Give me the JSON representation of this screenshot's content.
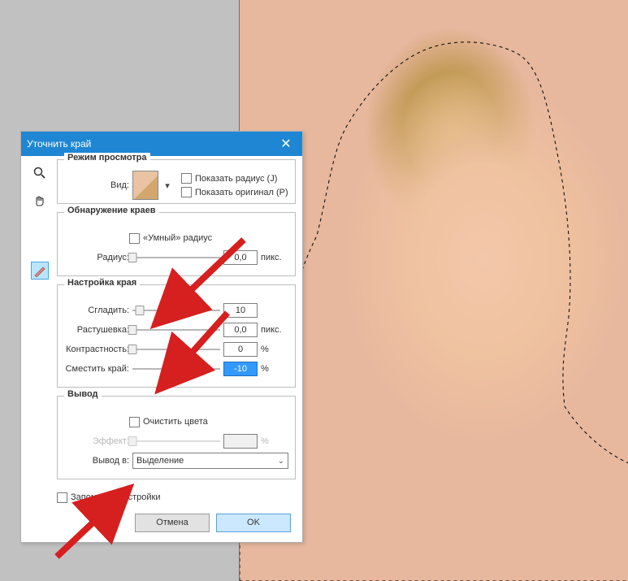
{
  "dialog": {
    "title": "Уточнить край",
    "view_section": {
      "title": "Режим просмотра",
      "view_label": "Вид:",
      "show_radius": "Показать радиус (J)",
      "show_original": "Показать оригинал (P)"
    },
    "edge_detect": {
      "title": "Обнаружение краев",
      "smart_radius": "«Умный» радиус",
      "radius_label": "Радиус:",
      "radius_value": "0,0",
      "radius_unit": "пикс."
    },
    "adjust": {
      "title": "Настройка края",
      "smooth_label": "Сгладить:",
      "smooth_value": "10",
      "feather_label": "Растушевка:",
      "feather_value": "0,0",
      "feather_unit": "пикс.",
      "contrast_label": "Контрастность:",
      "contrast_value": "0",
      "contrast_unit": "%",
      "shift_label": "Сместить край:",
      "shift_value": "-10",
      "shift_unit": "%"
    },
    "output": {
      "title": "Вывод",
      "decontaminate": "Очистить цвета",
      "effect_label": "Эффект:",
      "effect_unit": "%",
      "output_to_label": "Вывод в:",
      "output_to_value": "Выделение"
    },
    "remember_label": "Запомнить настройки",
    "cancel_label": "Отмена",
    "ok_label": "OK"
  }
}
